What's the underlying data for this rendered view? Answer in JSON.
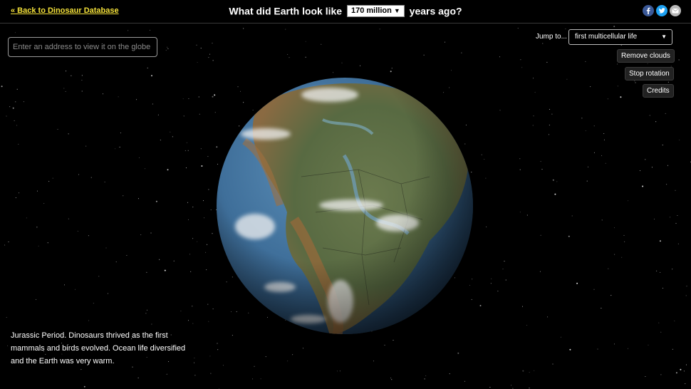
{
  "header": {
    "back_link": "« Back to Dinosaur Database",
    "title_pre": "What did Earth look like",
    "year_value": "170 million",
    "title_post": "years ago?"
  },
  "social": {
    "facebook_icon": "facebook-icon",
    "twitter_icon": "twitter-icon",
    "email_icon": "email-icon"
  },
  "search": {
    "value": "",
    "placeholder": "Enter an address to view it on the globe"
  },
  "controls": {
    "jump_label": "Jump to...",
    "jump_value": "first multicellular life",
    "remove_clouds": "Remove clouds",
    "stop_rotation": "Stop rotation",
    "credits": "Credits"
  },
  "description": "Jurassic Period. Dinosaurs thrived as the first mammals and birds evolved. Ocean life diversified and the Earth was very warm.",
  "colors": {
    "background": "#000000",
    "link": "#f5e23a",
    "ocean": "#3f6f9a",
    "land": "#5b6a44"
  }
}
